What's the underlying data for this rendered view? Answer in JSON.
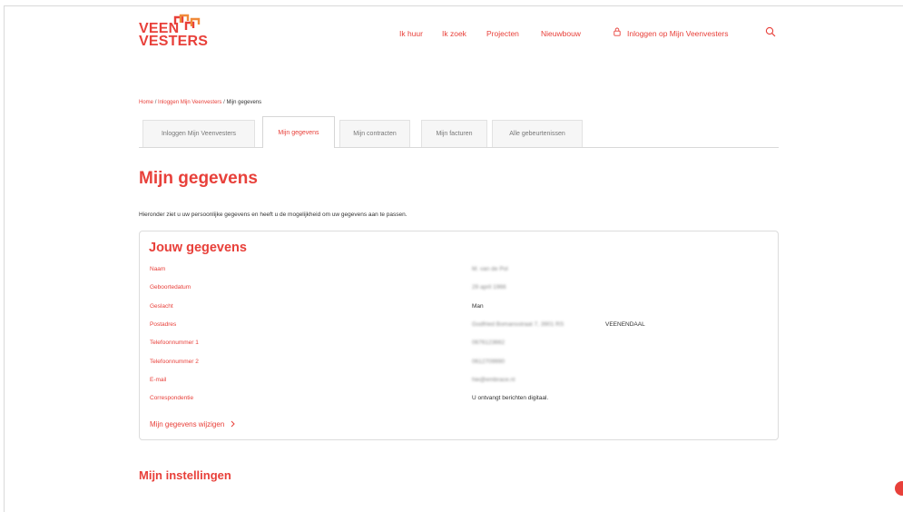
{
  "brand": {
    "logo_line1": "VEEN",
    "logo_line2": "VESTERS",
    "accent_color": "#e8403a"
  },
  "nav": {
    "items": [
      "Ik huur",
      "Ik zoek",
      "Projecten",
      "Nieuwbouw"
    ],
    "login": "Inloggen op Mijn Veenvesters"
  },
  "breadcrumb": {
    "home": "Home",
    "parent": "Inloggen Mijn Veenvesters",
    "current": "Mijn gegevens",
    "separator": "/"
  },
  "tabs": [
    {
      "label": "Inloggen Mijn Veenvesters",
      "active": false
    },
    {
      "label": "Mijn gegevens",
      "active": true
    },
    {
      "label": "Mijn contracten",
      "active": false
    },
    {
      "label": "Mijn facturen",
      "active": false
    },
    {
      "label": "Alle gebeurtenissen",
      "active": false
    }
  ],
  "page": {
    "title": "Mijn gegevens",
    "intro": "Hieronder ziet u uw persoonlijke gegevens en heeft u de mogelijkheid om uw gegevens aan te passen."
  },
  "card": {
    "title": "Jouw gegevens",
    "rows": [
      {
        "label": "Naam",
        "value": "M. van de Pol",
        "blurred": true
      },
      {
        "label": "Geboortedatum",
        "value": "29 april 1966",
        "blurred": true
      },
      {
        "label": "Geslacht",
        "value": "Man",
        "blurred": false
      },
      {
        "label": "Postadres",
        "value": "Godfried Bomansstraat 7, 3901 RS",
        "suffix": "VEENENDAAL",
        "blurred": true
      },
      {
        "label": "Telefoonnummer 1",
        "value": "0676123662",
        "blurred": true
      },
      {
        "label": "Telefoonnummer 2",
        "value": "0612709990",
        "blurred": true
      },
      {
        "label": "E-mail",
        "value": "hie@embrace.nl",
        "blurred": true
      },
      {
        "label": "Correspondentie",
        "value": "U ontvangt berichten digitaal.",
        "blurred": false
      }
    ],
    "edit_link": "Mijn gegevens wijzigen"
  },
  "settings_title": "Mijn instellingen"
}
